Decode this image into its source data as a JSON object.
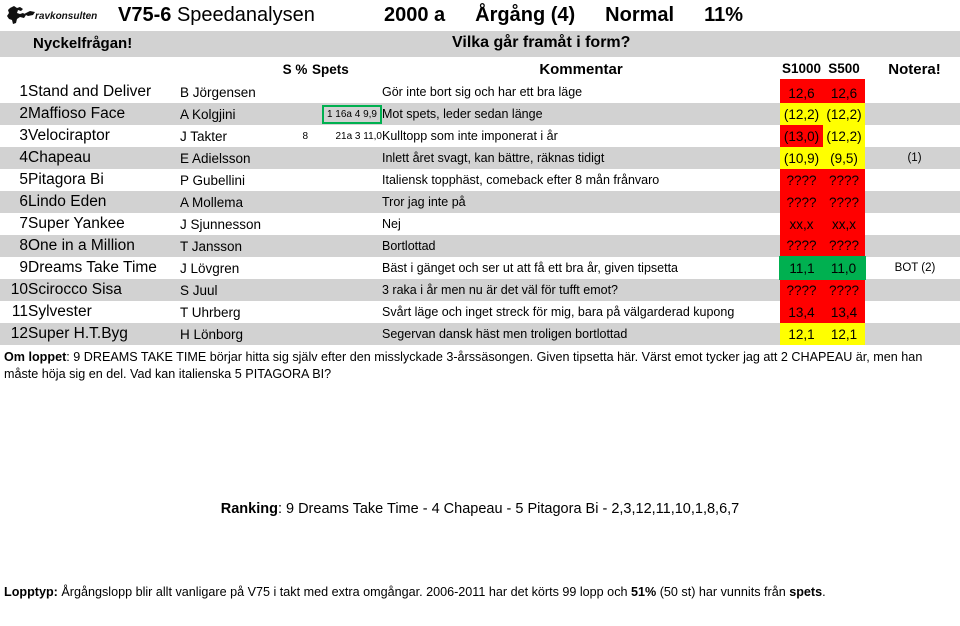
{
  "header": {
    "logo_text": "ravkonsulten",
    "race_code": "V75-6",
    "analysis_name": "Speedanalysen",
    "distance": "2000 a",
    "race_type": "Årgång (4)",
    "track_cond": "Normal",
    "percent": "11%"
  },
  "band": {
    "key_question_label": "Nyckelfrågan!",
    "question": "Vilka går framåt i form?"
  },
  "columns": {
    "sp": "S %",
    "spets": "Spets",
    "kommentar": "Kommentar",
    "s1000": "S1000",
    "s500": "S500",
    "notera": "Notera!"
  },
  "rows": [
    {
      "num": "1",
      "horse": "Stand and Deliver",
      "driver": "B Jörgensen",
      "sp": "",
      "spets": "",
      "spets_boxed": false,
      "kommentar": "Gör inte bort sig och har ett bra läge",
      "s1000": "12,6",
      "s500": "12,6",
      "s1000_fill": "red",
      "s500_fill": "red",
      "notera": ""
    },
    {
      "num": "2",
      "horse": "Maffioso Face",
      "driver": "A Kolgjini",
      "sp": "1",
      "spets": "16a 4  9,9",
      "spets_boxed": true,
      "kommentar": "Mot spets, leder sedan länge",
      "s1000": "(12,2)",
      "s500": "(12,2)",
      "s1000_fill": "yellow",
      "s500_fill": "yellow",
      "notera": ""
    },
    {
      "num": "3",
      "horse": "Velociraptor",
      "driver": "J Takter",
      "sp": "8",
      "spets": "21a 3 11,0",
      "spets_boxed": false,
      "kommentar": "Kulltopp som inte imponerat i år",
      "s1000": "(13,0)",
      "s500": "(12,2)",
      "s1000_fill": "red",
      "s500_fill": "yellow",
      "notera": ""
    },
    {
      "num": "4",
      "horse": "Chapeau",
      "driver": "E Adielsson",
      "sp": "",
      "spets": "",
      "spets_boxed": false,
      "kommentar": "Inlett året svagt, kan bättre, räknas tidigt",
      "s1000": "(10,9)",
      "s500": "(9,5)",
      "s1000_fill": "yellow",
      "s500_fill": "yellow",
      "notera": "(1)"
    },
    {
      "num": "5",
      "horse": "Pitagora Bi",
      "driver": "P Gubellini",
      "sp": "",
      "spets": "",
      "spets_boxed": false,
      "kommentar": "Italiensk topphäst, comeback efter 8 mån frånvaro",
      "s1000": "????",
      "s500": "????",
      "s1000_fill": "red",
      "s500_fill": "red",
      "notera": ""
    },
    {
      "num": "6",
      "horse": "Lindo Eden",
      "driver": "A Mollema",
      "sp": "",
      "spets": "",
      "spets_boxed": false,
      "kommentar": "Tror jag inte på",
      "s1000": "????",
      "s500": "????",
      "s1000_fill": "red",
      "s500_fill": "red",
      "notera": ""
    },
    {
      "num": "7",
      "horse": "Super Yankee",
      "driver": "J Sjunnesson",
      "sp": "",
      "spets": "",
      "spets_boxed": false,
      "kommentar": "Nej",
      "s1000": "xx,x",
      "s500": "xx,x",
      "s1000_fill": "red",
      "s500_fill": "red",
      "notera": ""
    },
    {
      "num": "8",
      "horse": "One in a Million",
      "driver": "T Jansson",
      "sp": "",
      "spets": "",
      "spets_boxed": false,
      "kommentar": "Bortlottad",
      "s1000": "????",
      "s500": "????",
      "s1000_fill": "red",
      "s500_fill": "red",
      "notera": ""
    },
    {
      "num": "9",
      "horse": "Dreams Take Time",
      "driver": "J Lövgren",
      "sp": "",
      "spets": "",
      "spets_boxed": false,
      "kommentar": "Bäst i gänget och ser ut att få ett bra år, given tipsetta",
      "s1000": "11,1",
      "s500": "11,0",
      "s1000_fill": "green",
      "s500_fill": "green",
      "notera": "BOT  (2)"
    },
    {
      "num": "10",
      "horse": "Scirocco Sisa",
      "driver": "S Juul",
      "sp": "",
      "spets": "",
      "spets_boxed": false,
      "kommentar": "3 raka i år men nu är det väl för tufft emot?",
      "s1000": "????",
      "s500": "????",
      "s1000_fill": "red",
      "s500_fill": "red",
      "notera": ""
    },
    {
      "num": "11",
      "horse": "Sylvester",
      "driver": "T Uhrberg",
      "sp": "",
      "spets": "",
      "spets_boxed": false,
      "kommentar": "Svårt läge och inget streck för mig, bara på välgarderad kupong",
      "s1000": "13,4",
      "s500": "13,4",
      "s1000_fill": "red",
      "s500_fill": "red",
      "notera": ""
    },
    {
      "num": "12",
      "horse": "Super H.T.Byg",
      "driver": "H Lönborg",
      "sp": "",
      "spets": "",
      "spets_boxed": false,
      "kommentar": "Segervan dansk häst men troligen bortlottad",
      "s1000": "12,1",
      "s500": "12,1",
      "s1000_fill": "yellow",
      "s500_fill": "yellow",
      "notera": ""
    }
  ],
  "about": {
    "label": "Om loppet",
    "text": ": 9 DREAMS TAKE TIME börjar hitta sig själv efter den misslyckade 3-årssäsongen. Given tipsetta här. Värst emot tycker jag att 2 CHAPEAU är, men han måste höja sig en del. Vad kan italienska 5 PITAGORA BI?"
  },
  "ranking": {
    "label": "Ranking",
    "text": ": 9 Dreams Take Time - 4 Chapeau - 5 Pitagora Bi - 2,3,12,11,10,1,8,6,7"
  },
  "footer": {
    "label": "Lopptyp:",
    "text_1": " Årgångslopp blir allt vanligare på V75 i takt med extra omgångar. 2006-2011 har det körts 99 lopp och ",
    "bold_1": "51",
    "bold_2": "%",
    "text_2": " (50 st) har vunnits från ",
    "bold_3": "spets",
    "text_3": "."
  },
  "colors": {
    "red": "#ff0000",
    "yellow": "#ffff00",
    "green": "#00b050",
    "band_grey": "#d2d2d2",
    "row_grey": "#d2d2d2"
  }
}
